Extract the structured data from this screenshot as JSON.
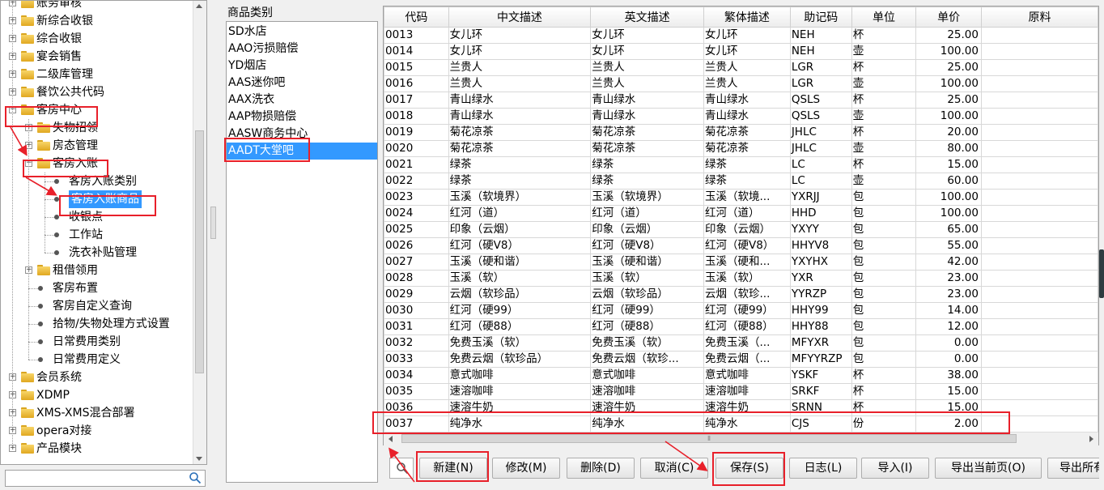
{
  "tree": {
    "items": [
      {
        "label": "账务审核",
        "level": 0,
        "type": "folder"
      },
      {
        "label": "新综合收银",
        "level": 0,
        "type": "folder"
      },
      {
        "label": "综合收银",
        "level": 0,
        "type": "folder"
      },
      {
        "label": "宴会销售",
        "level": 0,
        "type": "folder"
      },
      {
        "label": "二级库管理",
        "level": 0,
        "type": "folder"
      },
      {
        "label": "餐饮公共代码",
        "level": 0,
        "type": "folder"
      },
      {
        "label": "客房中心",
        "level": 0,
        "type": "folder",
        "expanded": true
      },
      {
        "label": "失物招领",
        "level": 1,
        "type": "folder"
      },
      {
        "label": "房态管理",
        "level": 1,
        "type": "folder"
      },
      {
        "label": "客房入账",
        "level": 1,
        "type": "folder",
        "expanded": true
      },
      {
        "label": "客房入账类别",
        "level": 2,
        "type": "leaf"
      },
      {
        "label": "客房入账商品",
        "level": 2,
        "type": "leaf",
        "selected": true
      },
      {
        "label": "收银点",
        "level": 2,
        "type": "leaf"
      },
      {
        "label": "工作站",
        "level": 2,
        "type": "leaf"
      },
      {
        "label": "洗衣补贴管理",
        "level": 2,
        "type": "leaf"
      },
      {
        "label": "租借领用",
        "level": 1,
        "type": "folder"
      },
      {
        "label": "客房布置",
        "level": 1,
        "type": "leaf"
      },
      {
        "label": "客房自定义查询",
        "level": 1,
        "type": "leaf"
      },
      {
        "label": "拾物/失物处理方式设置",
        "level": 1,
        "type": "leaf"
      },
      {
        "label": "日常费用类别",
        "level": 1,
        "type": "leaf"
      },
      {
        "label": "日常费用定义",
        "level": 1,
        "type": "leaf"
      },
      {
        "label": "会员系统",
        "level": 0,
        "type": "folder"
      },
      {
        "label": "XDMP",
        "level": 0,
        "type": "folder"
      },
      {
        "label": "XMS-XMS混合部署",
        "level": 0,
        "type": "folder"
      },
      {
        "label": "opera对接",
        "level": 0,
        "type": "folder"
      },
      {
        "label": "产品模块",
        "level": 0,
        "type": "folder"
      }
    ],
    "search_placeholder": ""
  },
  "categories": {
    "title": "商品类别",
    "items": [
      "SD水店",
      "AAO污损赔偿",
      "YD烟店",
      "AAS迷你吧",
      "AAX洗衣",
      "AAP物损赔偿",
      "AASW商务中心",
      "AADT大堂吧"
    ],
    "selected_index": 7
  },
  "grid": {
    "columns": [
      "代码",
      "中文描述",
      "英文描述",
      "繁体描述",
      "助记码",
      "单位",
      "单价",
      "原料"
    ],
    "rows": [
      [
        "0013",
        "女儿环",
        "女儿环",
        "女儿环",
        "NEH",
        "杯",
        "25.00",
        ""
      ],
      [
        "0014",
        "女儿环",
        "女儿环",
        "女儿环",
        "NEH",
        "壶",
        "100.00",
        ""
      ],
      [
        "0015",
        "兰贵人",
        "兰贵人",
        "兰贵人",
        "LGR",
        "杯",
        "25.00",
        ""
      ],
      [
        "0016",
        "兰贵人",
        "兰贵人",
        "兰贵人",
        "LGR",
        "壶",
        "100.00",
        ""
      ],
      [
        "0017",
        "青山绿水",
        "青山绿水",
        "青山绿水",
        "QSLS",
        "杯",
        "25.00",
        ""
      ],
      [
        "0018",
        "青山绿水",
        "青山绿水",
        "青山绿水",
        "QSLS",
        "壶",
        "100.00",
        ""
      ],
      [
        "0019",
        "菊花凉茶",
        "菊花凉茶",
        "菊花凉茶",
        "JHLC",
        "杯",
        "20.00",
        ""
      ],
      [
        "0020",
        "菊花凉茶",
        "菊花凉茶",
        "菊花凉茶",
        "JHLC",
        "壶",
        "80.00",
        ""
      ],
      [
        "0021",
        "绿茶",
        "绿茶",
        "绿茶",
        "LC",
        "杯",
        "15.00",
        ""
      ],
      [
        "0022",
        "绿茶",
        "绿茶",
        "绿茶",
        "LC",
        "壶",
        "60.00",
        ""
      ],
      [
        "0023",
        "玉溪（软境界）",
        "玉溪（软境界）",
        "玉溪（软境...",
        "YXRJJ",
        "包",
        "100.00",
        ""
      ],
      [
        "0024",
        "红河（道）",
        "红河（道）",
        "红河（道）",
        "HHD",
        "包",
        "100.00",
        ""
      ],
      [
        "0025",
        "印象（云烟）",
        "印象（云烟）",
        "印象（云烟）",
        "YXYY",
        "包",
        "65.00",
        ""
      ],
      [
        "0026",
        "红河（硬V8）",
        "红河（硬V8）",
        "红河（硬V8）",
        "HHYV8",
        "包",
        "55.00",
        ""
      ],
      [
        "0027",
        "玉溪（硬和谐）",
        "玉溪（硬和谐）",
        "玉溪（硬和...",
        "YXYHX",
        "包",
        "42.00",
        ""
      ],
      [
        "0028",
        "玉溪（软）",
        "玉溪（软）",
        "玉溪（软）",
        "YXR",
        "包",
        "23.00",
        ""
      ],
      [
        "0029",
        "云烟（软珍品）",
        "云烟（软珍品）",
        "云烟（软珍...",
        "YYRZP",
        "包",
        "23.00",
        ""
      ],
      [
        "0030",
        "红河（硬99）",
        "红河（硬99）",
        "红河（硬99）",
        "HHY99",
        "包",
        "14.00",
        ""
      ],
      [
        "0031",
        "红河（硬88）",
        "红河（硬88）",
        "红河（硬88）",
        "HHY88",
        "包",
        "12.00",
        ""
      ],
      [
        "0032",
        "免费玉溪（软）",
        "免费玉溪（软）",
        "免费玉溪（...",
        "MFYXR",
        "包",
        "0.00",
        ""
      ],
      [
        "0033",
        "免费云烟（软珍品）",
        "免费云烟（软珍...",
        "免费云烟（...",
        "MFYYRZP",
        "包",
        "0.00",
        ""
      ],
      [
        "0034",
        "意式咖啡",
        "意式咖啡",
        "意式咖啡",
        "YSKF",
        "杯",
        "38.00",
        ""
      ],
      [
        "0035",
        "速溶咖啡",
        "速溶咖啡",
        "速溶咖啡",
        "SRKF",
        "杯",
        "15.00",
        ""
      ],
      [
        "0036",
        "速溶牛奶",
        "速溶牛奶",
        "速溶牛奶",
        "SRNN",
        "杯",
        "15.00",
        ""
      ],
      [
        "0037",
        "纯净水",
        "纯净水",
        "纯净水",
        "CJS",
        "份",
        "2.00",
        ""
      ]
    ]
  },
  "toolbar": {
    "new_label": "新建(N)",
    "edit_label": "修改(M)",
    "delete_label": "删除(D)",
    "cancel_label": "取消(C)",
    "save_label": "保存(S)",
    "log_label": "日志(L)",
    "import_label": "导入(I)",
    "export_page_label": "导出当前页(O)",
    "export_all_label": "导出所有"
  },
  "colors": {
    "selection": "#3399ff",
    "annotation": "#e8202a"
  }
}
